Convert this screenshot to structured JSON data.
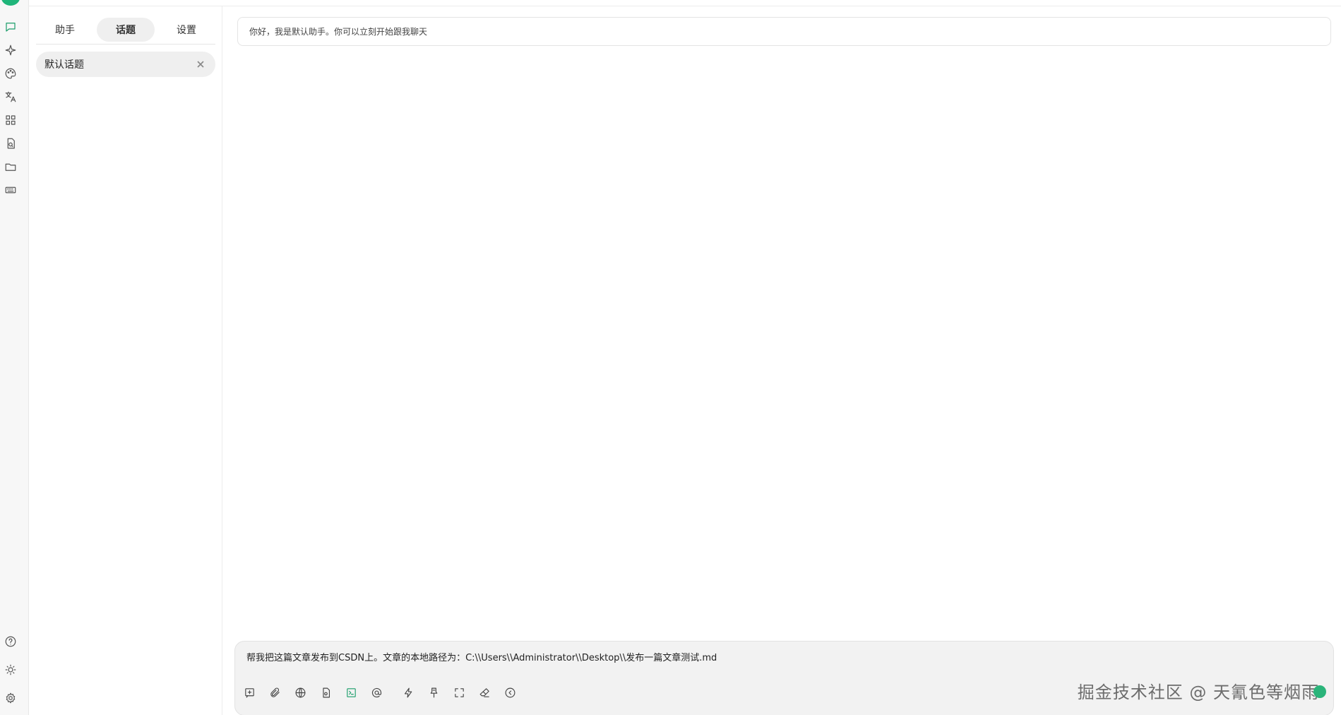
{
  "panel": {
    "tabs": [
      {
        "label": "助手"
      },
      {
        "label": "话题"
      },
      {
        "label": "设置"
      }
    ],
    "active_tab": "话题",
    "topics": [
      {
        "label": "默认话题"
      }
    ]
  },
  "main": {
    "greeting": "你好，我是默认助手。你可以立刻开始跟我聊天",
    "input_text": "帮我把这篇文章发布到CSDN上。文章的本地路径为：C:\\\\Users\\\\Administrator\\\\Desktop\\\\发布一篇文章测试.md",
    "watermark": "掘金技术社区 @ 天氰色等烟雨"
  },
  "colors": {
    "accent": "#1a9d6a",
    "rail_bg": "#f7f7f7",
    "composer_bg": "#f2f2f2"
  },
  "icons": {
    "rail_top": [
      "chat-icon",
      "sparkle-icon",
      "palette-icon",
      "translate-icon",
      "apps-grid-icon",
      "file-search-icon",
      "folder-icon",
      "keyboard-icon"
    ],
    "rail_bottom": [
      "help-icon",
      "sun-icon",
      "gear-icon"
    ],
    "composer_tools": [
      "new-topic-icon",
      "attachment-icon",
      "globe-icon",
      "knowledge-icon",
      "terminal-icon",
      "mention-icon",
      "lightning-icon",
      "pin-icon",
      "fullscreen-icon",
      "eraser-icon",
      "history-icon"
    ]
  }
}
